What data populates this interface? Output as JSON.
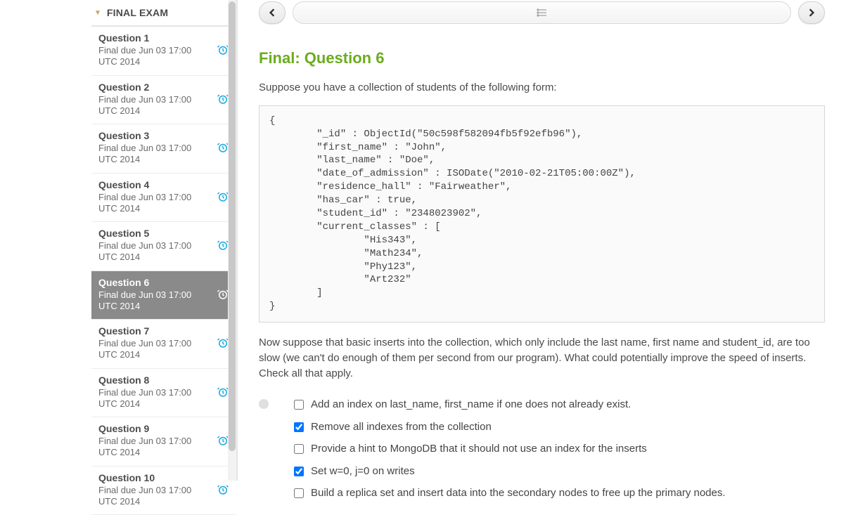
{
  "sidebar": {
    "section_label": "FINAL EXAM",
    "items": [
      {
        "title": "Question 1",
        "sub": "Final due Jun 03 17:00 UTC 2014",
        "active": false
      },
      {
        "title": "Question 2",
        "sub": "Final due Jun 03 17:00 UTC 2014",
        "active": false
      },
      {
        "title": "Question 3",
        "sub": "Final due Jun 03 17:00 UTC 2014",
        "active": false
      },
      {
        "title": "Question 4",
        "sub": "Final due Jun 03 17:00 UTC 2014",
        "active": false
      },
      {
        "title": "Question 5",
        "sub": "Final due Jun 03 17:00 UTC 2014",
        "active": false
      },
      {
        "title": "Question 6",
        "sub": "Final due Jun 03 17:00 UTC 2014",
        "active": true
      },
      {
        "title": "Question 7",
        "sub": "Final due Jun 03 17:00 UTC 2014",
        "active": false
      },
      {
        "title": "Question 8",
        "sub": "Final due Jun 03 17:00 UTC 2014",
        "active": false
      },
      {
        "title": "Question 9",
        "sub": "Final due Jun 03 17:00 UTC 2014",
        "active": false
      },
      {
        "title": "Question 10",
        "sub": "Final due Jun 03 17:00 UTC 2014",
        "active": false
      }
    ]
  },
  "main": {
    "title": "Final: Question 6",
    "intro": "Suppose you have a collection of students of the following form:",
    "code": "{\n        \"_id\" : ObjectId(\"50c598f582094fb5f92efb96\"),\n        \"first_name\" : \"John\",\n        \"last_name\" : \"Doe\",\n        \"date_of_admission\" : ISODate(\"2010-02-21T05:00:00Z\"),\n        \"residence_hall\" : \"Fairweather\",\n        \"has_car\" : true,\n        \"student_id\" : \"2348023902\",\n        \"current_classes\" : [\n                \"His343\",\n                \"Math234\",\n                \"Phy123\",\n                \"Art232\"\n        ]\n}",
    "prompt": "Now suppose that basic inserts into the collection, which only include the last name, first name and student_id, are too slow (we can't do enough of them per second from our program). What could potentially improve the speed of inserts. Check all that apply.",
    "answers": [
      {
        "label": "Add an index on last_name, first_name if one does not already exist.",
        "checked": false
      },
      {
        "label": "Remove all indexes from the collection",
        "checked": true
      },
      {
        "label": "Provide a hint to MongoDB that it should not use an index for the inserts",
        "checked": false
      },
      {
        "label": "Set w=0, j=0 on writes",
        "checked": true
      },
      {
        "label": "Build a replica set and insert data into the secondary nodes to free up the primary nodes.",
        "checked": false
      }
    ]
  }
}
